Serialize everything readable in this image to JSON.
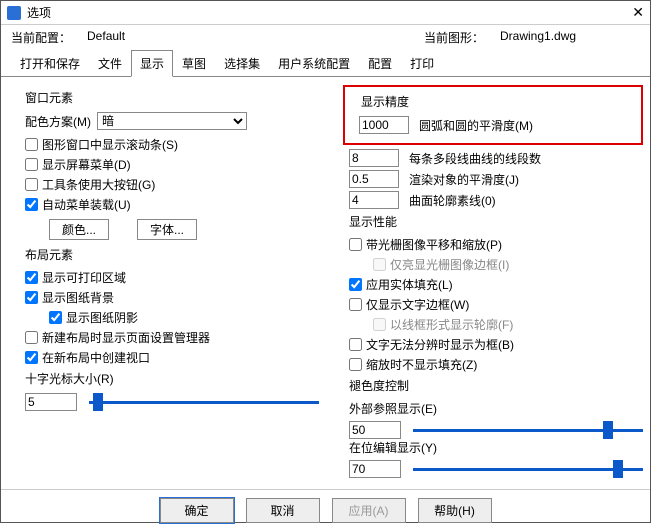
{
  "title": "选项",
  "top": {
    "cur_cfg_lbl": "当前配置：",
    "cur_cfg_val": "Default",
    "cur_dwg_lbl": "当前图形：",
    "cur_dwg_val": "Drawing1.dwg"
  },
  "tabs": [
    "打开和保存",
    "文件",
    "显示",
    "草图",
    "选择集",
    "用户系统配置",
    "配置",
    "打印"
  ],
  "active_tab": "显示",
  "left": {
    "window_elems_title": "窗口元素",
    "colorscheme_lbl": "配色方案(M)",
    "colorscheme_val": "暗",
    "cb_scrollbars": "图形窗口中显示滚动条(S)",
    "cb_screenmenu": "显示屏幕菜单(D)",
    "cb_bigbtn": "工具条使用大按钮(G)",
    "cb_automenu": "自动菜单装载(U)",
    "btn_color": "颜色...",
    "btn_font": "字体...",
    "layout_title": "布局元素",
    "cb_printable": "显示可打印区域",
    "cb_paperbg": "显示图纸背景",
    "cb_papershadow": "显示图纸阴影",
    "cb_pagesetup": "新建布局时显示页面设置管理器",
    "cb_viewport": "在新布局中创建视口",
    "crosshair_lbl": "十字光标大小(R)",
    "crosshair_val": "5"
  },
  "right": {
    "precision_title": "显示精度",
    "arc_val": "1000",
    "arc_lbl": "圆弧和圆的平滑度(M)",
    "poly_val": "8",
    "poly_lbl": "每条多段线曲线的线段数",
    "render_val": "0.5",
    "render_lbl": "渲染对象的平滑度(J)",
    "surf_val": "4",
    "surf_lbl": "曲面轮廓素线(0)",
    "perf_title": "显示性能",
    "cb_raster": "带光栅图像平移和缩放(P)",
    "cb_highlight": "仅亮显光栅图像边框(I)",
    "cb_solidfill": "应用实体填充(L)",
    "cb_textframe": "仅显示文字边框(W)",
    "cb_wireframe": "以线框形式显示轮廓(F)",
    "cb_truetype": "文字无法分辨时显示为框(B)",
    "cb_nofillzoom": "缩放时不显示填充(Z)",
    "fade_title": "褪色度控制",
    "fade_ext_lbl": "外部参照显示(E)",
    "fade_ext_val": "50",
    "fade_inplace_lbl": "在位编辑显示(Y)",
    "fade_inplace_val": "70"
  },
  "footer": {
    "ok": "确定",
    "cancel": "取消",
    "apply": "应用(A)",
    "help": "帮助(H)"
  }
}
